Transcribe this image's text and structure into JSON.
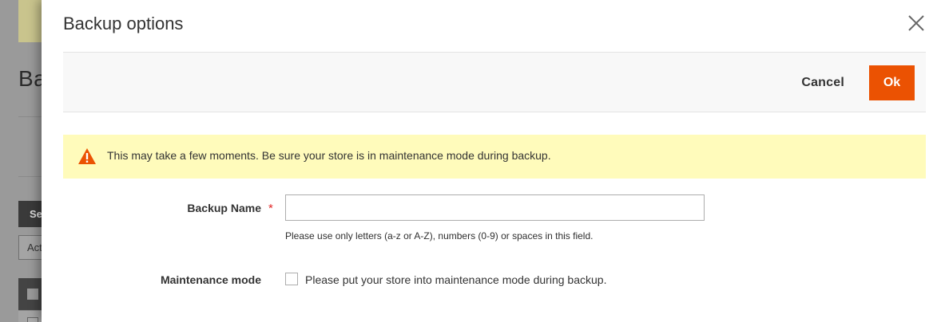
{
  "background": {
    "title_fragment": "Ba",
    "button_fragment": "Se",
    "select_fragment": "Act"
  },
  "modal": {
    "title": "Backup options",
    "close_icon": "close-icon",
    "toolbar": {
      "cancel_label": "Cancel",
      "ok_label": "Ok"
    },
    "warning": {
      "icon": "warning-triangle-icon",
      "text": "This may take a few moments. Be sure your store is in maintenance mode during backup."
    },
    "fields": {
      "backup_name": {
        "label": "Backup Name",
        "required_marker": "*",
        "value": "",
        "note": "Please use only letters (a-z or A-Z), numbers (0-9) or spaces in this field."
      },
      "maintenance_mode": {
        "label": "Maintenance mode",
        "checked": false,
        "checkbox_label": "Please put your store into maintenance mode during backup."
      }
    }
  },
  "colors": {
    "accent": "#eb5202",
    "warning_bg": "#fffbbb",
    "warning_icon": "#eb5202",
    "required": "#e22626"
  }
}
